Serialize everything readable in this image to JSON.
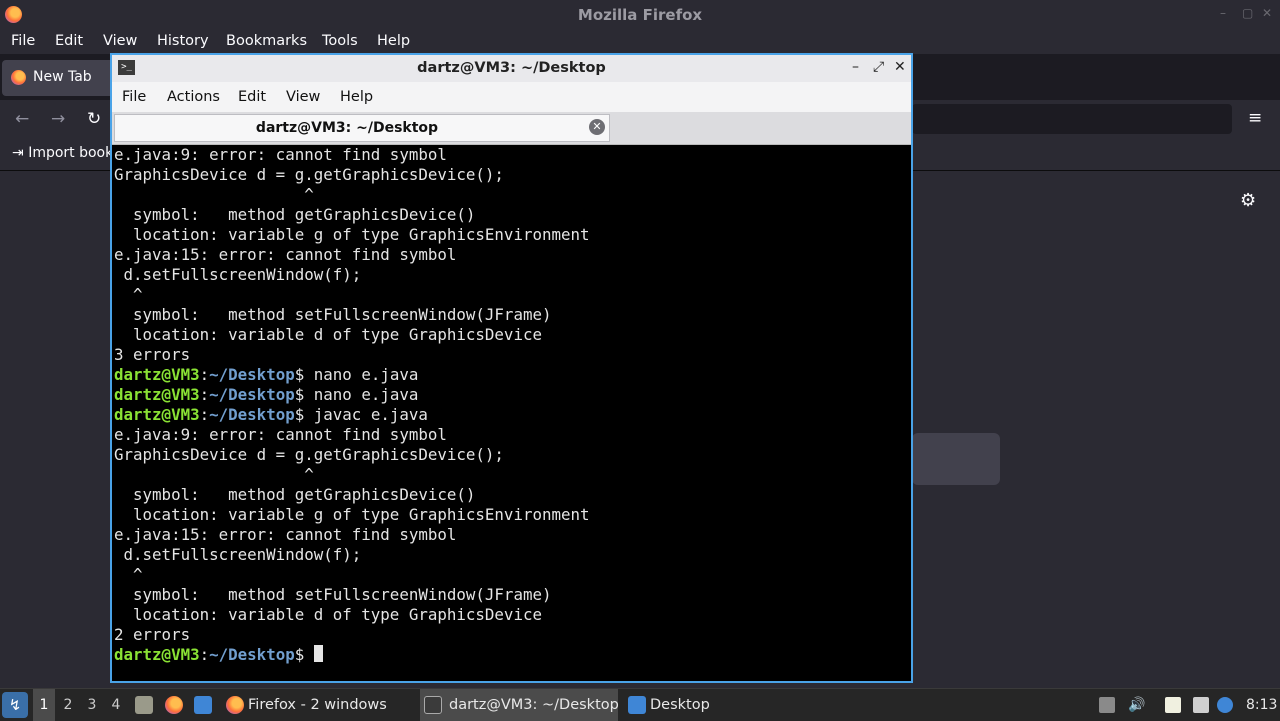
{
  "firefox": {
    "window_title": "Mozilla Firefox",
    "menu": [
      "File",
      "Edit",
      "View",
      "History",
      "Bookmarks",
      "Tools",
      "Help"
    ],
    "tab_label": "New Tab",
    "bookmark_label": "Import bookr",
    "icons": {
      "back": "←",
      "forward": "→",
      "reload": "↻",
      "menu": "≡",
      "gear": "⚙",
      "min": "–",
      "max": "▢",
      "close": "✕"
    }
  },
  "terminal": {
    "title": "dartz@VM3: ~/Desktop",
    "menu": [
      "File",
      "Actions",
      "Edit",
      "View",
      "Help"
    ],
    "tab_label": "dartz@VM3: ~/Desktop",
    "controls": {
      "minimize": "–",
      "maximize": "⤢",
      "close": "✕",
      "tab_close": "✕"
    },
    "prompt": {
      "user": "dartz@VM3",
      "sep": ":",
      "dir": "~/Desktop",
      "symbol": "$"
    },
    "lines": [
      {
        "type": "out",
        "text": "e.java:9: error: cannot find symbol"
      },
      {
        "type": "out",
        "text": "GraphicsDevice d = g.getGraphicsDevice();"
      },
      {
        "type": "out",
        "text": "                    ^"
      },
      {
        "type": "out",
        "text": "  symbol:   method getGraphicsDevice()"
      },
      {
        "type": "out",
        "text": "  location: variable g of type GraphicsEnvironment"
      },
      {
        "type": "out",
        "text": "e.java:15: error: cannot find symbol"
      },
      {
        "type": "out",
        "text": " d.setFullscreenWindow(f);"
      },
      {
        "type": "out",
        "text": "  ^"
      },
      {
        "type": "out",
        "text": "  symbol:   method setFullscreenWindow(JFrame)"
      },
      {
        "type": "out",
        "text": "  location: variable d of type GraphicsDevice"
      },
      {
        "type": "out",
        "text": "3 errors"
      },
      {
        "type": "prompt",
        "text": " nano e.java"
      },
      {
        "type": "prompt",
        "text": " nano e.java"
      },
      {
        "type": "prompt",
        "text": " javac e.java"
      },
      {
        "type": "out",
        "text": "e.java:9: error: cannot find symbol"
      },
      {
        "type": "out",
        "text": "GraphicsDevice d = g.getGraphicsDevice();"
      },
      {
        "type": "out",
        "text": "                    ^"
      },
      {
        "type": "out",
        "text": "  symbol:   method getGraphicsDevice()"
      },
      {
        "type": "out",
        "text": "  location: variable g of type GraphicsEnvironment"
      },
      {
        "type": "out",
        "text": "e.java:15: error: cannot find symbol"
      },
      {
        "type": "out",
        "text": " d.setFullscreenWindow(f);"
      },
      {
        "type": "out",
        "text": "  ^"
      },
      {
        "type": "out",
        "text": "  symbol:   method setFullscreenWindow(JFrame)"
      },
      {
        "type": "out",
        "text": "  location: variable d of type GraphicsDevice"
      },
      {
        "type": "out",
        "text": "2 errors"
      },
      {
        "type": "prompt",
        "text": " ",
        "cursor": true
      }
    ]
  },
  "taskbar": {
    "workspaces": [
      "1",
      "2",
      "3",
      "4"
    ],
    "tasks": [
      {
        "label": "Firefox - 2 windows",
        "icon": "firefox-icon"
      },
      {
        "label": "dartz@VM3: ~/Desktop",
        "icon": "terminal-icon"
      },
      {
        "label": "Desktop",
        "icon": "folder-icon"
      }
    ],
    "start_glyph": "↯",
    "clock": "8:13"
  },
  "colors": {
    "prompt_user": "#8ae234",
    "prompt_dir": "#729fcf",
    "terminal_border": "#4aa3e8",
    "firefox_bg": "#2b2a33"
  }
}
